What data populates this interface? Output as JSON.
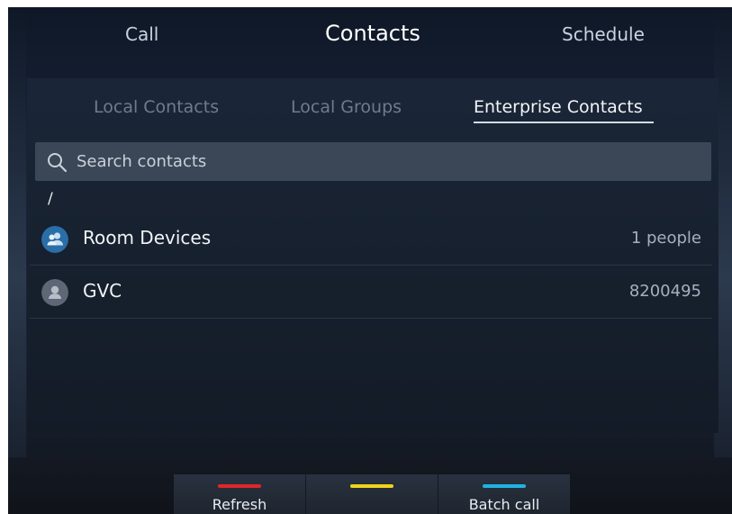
{
  "top_tabs": [
    {
      "label": "Call"
    },
    {
      "label": "Contacts"
    },
    {
      "label": "Schedule"
    }
  ],
  "sub_tabs": [
    {
      "label": "Local Contacts"
    },
    {
      "label": "Local Groups"
    },
    {
      "label": "Enterprise Contacts"
    }
  ],
  "active_top_tab": "Contacts",
  "active_sub_tab": "Enterprise Contacts",
  "search": {
    "placeholder": "Search contacts",
    "icon": "search-icon"
  },
  "path": "/",
  "items": [
    {
      "name": "Room Devices",
      "meta": "1 people",
      "icon": "group-icon"
    },
    {
      "name": "GVC",
      "meta": "8200495",
      "icon": "person-icon"
    }
  ],
  "softkeys": [
    {
      "label": "Refresh",
      "color": "#e0262b"
    },
    {
      "label": "",
      "color": "#f0d21e"
    },
    {
      "label": "Batch call",
      "color": "#1fb4e0"
    }
  ]
}
